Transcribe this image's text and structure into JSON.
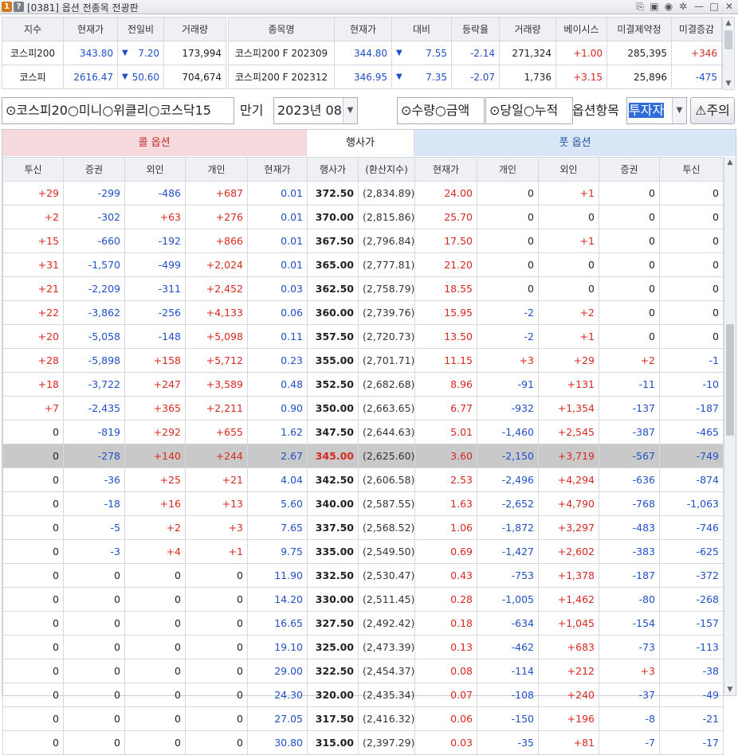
{
  "window": {
    "badge1": "1",
    "badge2": "?",
    "title": "[0381] 옵션 전종목 전광판",
    "buttons": [
      "⎘",
      "▣",
      "◉",
      "✲",
      "—",
      "□",
      "✕"
    ]
  },
  "index_table": {
    "headers": [
      "지수",
      "현재가",
      "전일비",
      "거래량"
    ],
    "rows": [
      {
        "name": "코스피200",
        "price": "343.80",
        "arrow": "▼",
        "change": "7.20",
        "volume": "173,994"
      },
      {
        "name": "코스피",
        "price": "2616.47",
        "arrow": "▼",
        "change": "50.60",
        "volume": "704,674"
      }
    ]
  },
  "futures_table": {
    "headers": [
      "종목명",
      "현재가",
      "대비",
      "등락율",
      "거래량",
      "베이시스",
      "미결제약정",
      "미결증감"
    ],
    "rows": [
      {
        "name": "코스피200 F 202309",
        "price": "344.80",
        "arrow": "▼",
        "change": "7.55",
        "rate": "-2.14",
        "volume": "271,324",
        "basis": "+1.00",
        "oi": "285,395",
        "oi_change": "+346"
      },
      {
        "name": "코스피200 F 202312",
        "price": "346.95",
        "arrow": "▼",
        "change": "7.35",
        "rate": "-2.07",
        "volume": "1,736",
        "basis": "+3.15",
        "oi": "25,896",
        "oi_change": "-475"
      }
    ]
  },
  "toolbar": {
    "market_options": "⊙코스피20○미니○위클리○코스닥15",
    "expiry_label": "만기",
    "expiry_value": "2023년 08",
    "qty_options": "⊙수량○금액",
    "period_options": "⊙당일○누적",
    "item_label": "옵션항목",
    "item_value": "투자자",
    "warn_label": "주의"
  },
  "chain": {
    "call_header": "콜 옵션",
    "strike_header": "행사가",
    "put_header": "풋 옵션",
    "columns": [
      "투신",
      "증권",
      "외인",
      "개인",
      "현재가",
      "행사가",
      "(환산지수)",
      "현재가",
      "개인",
      "외인",
      "증권",
      "투신"
    ],
    "rows": [
      {
        "c": [
          "+29",
          "-299",
          "-486",
          "+687",
          "0.01"
        ],
        "k": "372.50",
        "x": "(2,834.89)",
        "p": [
          "24.00",
          "0",
          "+1",
          "0",
          "0"
        ]
      },
      {
        "c": [
          "+2",
          "-302",
          "+63",
          "+276",
          "0.01"
        ],
        "k": "370.00",
        "x": "(2,815.86)",
        "p": [
          "25.70",
          "0",
          "0",
          "0",
          "0"
        ]
      },
      {
        "c": [
          "+15",
          "-660",
          "-192",
          "+866",
          "0.01"
        ],
        "k": "367.50",
        "x": "(2,796.84)",
        "p": [
          "17.50",
          "0",
          "+1",
          "0",
          "0"
        ]
      },
      {
        "c": [
          "+31",
          "-1,570",
          "-499",
          "+2,024",
          "0.01"
        ],
        "k": "365.00",
        "x": "(2,777.81)",
        "p": [
          "21.20",
          "0",
          "0",
          "0",
          "0"
        ]
      },
      {
        "c": [
          "+21",
          "-2,209",
          "-311",
          "+2,452",
          "0.03"
        ],
        "k": "362.50",
        "x": "(2,758.79)",
        "p": [
          "18.55",
          "0",
          "0",
          "0",
          "0"
        ]
      },
      {
        "c": [
          "+22",
          "-3,862",
          "-256",
          "+4,133",
          "0.06"
        ],
        "k": "360.00",
        "x": "(2,739.76)",
        "p": [
          "15.95",
          "-2",
          "+2",
          "0",
          "0"
        ]
      },
      {
        "c": [
          "+20",
          "-5,058",
          "-148",
          "+5,098",
          "0.11"
        ],
        "k": "357.50",
        "x": "(2,720.73)",
        "p": [
          "13.50",
          "-2",
          "+1",
          "0",
          "0"
        ]
      },
      {
        "c": [
          "+28",
          "-5,898",
          "+158",
          "+5,712",
          "0.23"
        ],
        "k": "355.00",
        "x": "(2,701.71)",
        "p": [
          "11.15",
          "+3",
          "+29",
          "+2",
          "-1"
        ]
      },
      {
        "c": [
          "+18",
          "-3,722",
          "+247",
          "+3,589",
          "0.48"
        ],
        "k": "352.50",
        "x": "(2,682.68)",
        "p": [
          "8.96",
          "-91",
          "+131",
          "-11",
          "-10"
        ]
      },
      {
        "c": [
          "+7",
          "-2,435",
          "+365",
          "+2,211",
          "0.90"
        ],
        "k": "350.00",
        "x": "(2,663.65)",
        "p": [
          "6.77",
          "-932",
          "+1,354",
          "-137",
          "-187"
        ]
      },
      {
        "c": [
          "0",
          "-819",
          "+292",
          "+655",
          "1.62"
        ],
        "k": "347.50",
        "x": "(2,644.63)",
        "p": [
          "5.01",
          "-1,460",
          "+2,545",
          "-387",
          "-465"
        ]
      },
      {
        "c": [
          "0",
          "-278",
          "+140",
          "+244",
          "2.67"
        ],
        "k": "345.00",
        "x": "(2,625.60)",
        "p": [
          "3.60",
          "-2,150",
          "+3,719",
          "-567",
          "-749"
        ],
        "atm": true
      },
      {
        "c": [
          "0",
          "-36",
          "+25",
          "+21",
          "4.04"
        ],
        "k": "342.50",
        "x": "(2,606.58)",
        "p": [
          "2.53",
          "-2,496",
          "+4,294",
          "-636",
          "-874"
        ]
      },
      {
        "c": [
          "0",
          "-18",
          "+16",
          "+13",
          "5.60"
        ],
        "k": "340.00",
        "x": "(2,587.55)",
        "p": [
          "1.63",
          "-2,652",
          "+4,790",
          "-768",
          "-1,063"
        ]
      },
      {
        "c": [
          "0",
          "-5",
          "+2",
          "+3",
          "7.65"
        ],
        "k": "337.50",
        "x": "(2,568.52)",
        "p": [
          "1.06",
          "-1,872",
          "+3,297",
          "-483",
          "-746"
        ]
      },
      {
        "c": [
          "0",
          "-3",
          "+4",
          "+1",
          "9.75"
        ],
        "k": "335.00",
        "x": "(2,549.50)",
        "p": [
          "0.69",
          "-1,427",
          "+2,602",
          "-383",
          "-625"
        ]
      },
      {
        "c": [
          "0",
          "0",
          "0",
          "0",
          "11.90"
        ],
        "k": "332.50",
        "x": "(2,530.47)",
        "p": [
          "0.43",
          "-753",
          "+1,378",
          "-187",
          "-372"
        ]
      },
      {
        "c": [
          "0",
          "0",
          "0",
          "0",
          "14.20"
        ],
        "k": "330.00",
        "x": "(2,511.45)",
        "p": [
          "0.28",
          "-1,005",
          "+1,462",
          "-80",
          "-268"
        ]
      },
      {
        "c": [
          "0",
          "0",
          "0",
          "0",
          "16.65"
        ],
        "k": "327.50",
        "x": "(2,492.42)",
        "p": [
          "0.18",
          "-634",
          "+1,045",
          "-154",
          "-157"
        ]
      },
      {
        "c": [
          "0",
          "0",
          "0",
          "0",
          "19.10"
        ],
        "k": "325.00",
        "x": "(2,473.39)",
        "p": [
          "0.13",
          "-462",
          "+683",
          "-73",
          "-113"
        ]
      },
      {
        "c": [
          "0",
          "0",
          "0",
          "0",
          "29.00"
        ],
        "k": "322.50",
        "x": "(2,454.37)",
        "p": [
          "0.08",
          "-114",
          "+212",
          "+3",
          "-38"
        ]
      },
      {
        "c": [
          "0",
          "0",
          "0",
          "0",
          "24.30"
        ],
        "k": "320.00",
        "x": "(2,435.34)",
        "p": [
          "0.07",
          "-108",
          "+240",
          "-37",
          "-49"
        ]
      },
      {
        "c": [
          "0",
          "0",
          "0",
          "0",
          "27.05"
        ],
        "k": "317.50",
        "x": "(2,416.32)",
        "p": [
          "0.06",
          "-150",
          "+196",
          "-8",
          "-21"
        ]
      },
      {
        "c": [
          "0",
          "0",
          "0",
          "0",
          "30.80"
        ],
        "k": "315.00",
        "x": "(2,397.29)",
        "p": [
          "0.03",
          "-35",
          "+81",
          "-7",
          "-17"
        ]
      }
    ]
  },
  "colors": {
    "up": "#d8281f",
    "down": "#2050c8",
    "neutral": "#222222",
    "atm_row": "#c9c9c9",
    "call_header": "#f6d9dc",
    "put_header": "#d8e6f5"
  }
}
